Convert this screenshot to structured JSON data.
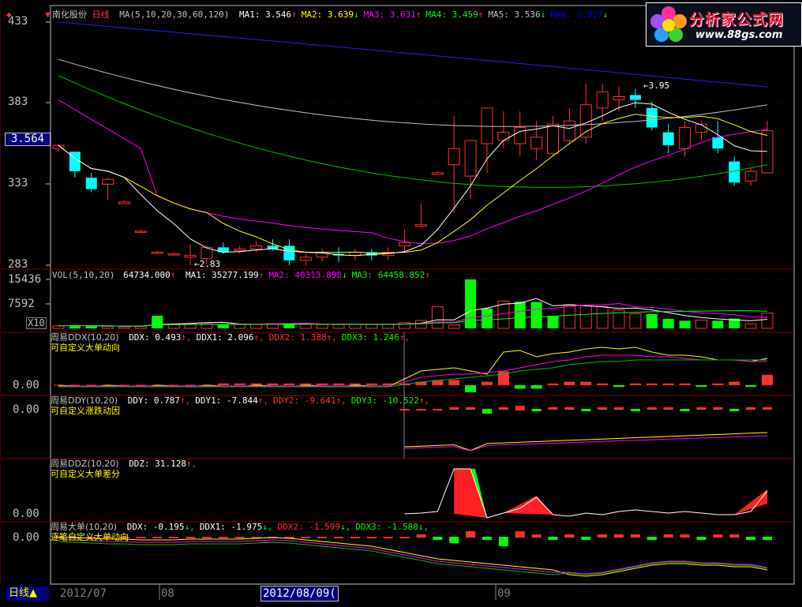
{
  "main": {
    "stock_name": "南化股份",
    "period": "日线",
    "ma_title": "MA(5,10,20,30,60,120)",
    "ma": [
      {
        "label": "MA1:",
        "value": "3.546",
        "arrow": "↑",
        "color": "#ffffff"
      },
      {
        "label": "MA2:",
        "value": "3.639",
        "arrow": "↓",
        "color": "#ffff00"
      },
      {
        "label": "MA3:",
        "value": "3.631",
        "arrow": "↑",
        "color": "#ff00ff"
      },
      {
        "label": "MA4:",
        "value": "3.459",
        "arrow": "↑",
        "color": "#00ff00"
      },
      {
        "label": "MA5:",
        "value": "3.536",
        "arrow": "↓",
        "color": "#c0c0c0"
      },
      {
        "label": "MA6:",
        "value": "3.917",
        "arrow": "↓",
        "color": "#0000ff"
      }
    ],
    "y_ticks": [
      "433",
      "383",
      "333",
      "283"
    ],
    "current_price": "3.564",
    "high_mark": "3.95",
    "low_mark": "2.83"
  },
  "vol": {
    "title": "VOL(5,10,20)",
    "value": "64734.000",
    "value_arrow": "↑",
    "ma": [
      {
        "label": "MA1:",
        "value": "35277.199",
        "arrow": "↑",
        "color": "#ffffff"
      },
      {
        "label": "MA2:",
        "value": "40313.898",
        "arrow": "↓",
        "color": "#ff00ff"
      },
      {
        "label": "MA3:",
        "value": "64458.852",
        "arrow": "↑",
        "color": "#00ff00"
      }
    ],
    "y_ticks": [
      "15436",
      "7592"
    ],
    "unit": "X10"
  },
  "ddx": {
    "title": "周易DDX(10,20)",
    "items": [
      {
        "label": "DDX:",
        "value": "0.493",
        "arrow": "↑",
        "color": "#ffffff"
      },
      {
        "label": "DDX1:",
        "value": "2.096",
        "arrow": "↑",
        "color": "#ffffff"
      },
      {
        "label": "DDX2:",
        "value": "1.388",
        "arrow": "↑",
        "color": "#ff3030"
      },
      {
        "label": "DDX3:",
        "value": "1.246",
        "arrow": "↑",
        "color": "#00ff00"
      }
    ],
    "subtitle": "可自定义大单动向",
    "zero": "0.00"
  },
  "ddy": {
    "title": "周易DDY(10,20)",
    "items": [
      {
        "label": "DDY:",
        "value": "0.787",
        "arrow": "↑",
        "color": "#ffffff"
      },
      {
        "label": "DDY1:",
        "value": "-7.844",
        "arrow": "↑",
        "color": "#ffffff"
      },
      {
        "label": "DDY2:",
        "value": "-9.641",
        "arrow": "↑",
        "color": "#ff3030"
      },
      {
        "label": "DDY3:",
        "value": "-10.522",
        "arrow": "↑",
        "color": "#00ff00"
      }
    ],
    "subtitle": "可自定义涨跌动因",
    "zero": "0.00"
  },
  "ddz": {
    "title": "周易DDZ(10,20)",
    "items": [
      {
        "label": "DDZ:",
        "value": "31.128",
        "arrow": "↑",
        "color": "#ffffff"
      }
    ],
    "subtitle": "可自定义大单差分",
    "zero": "0.00"
  },
  "big": {
    "title": "周易大单(10,20)",
    "items": [
      {
        "label": "DDX:",
        "value": "-0.195",
        "arrow": "↓",
        "color": "#ffffff"
      },
      {
        "label": "DDX1:",
        "value": "-1.975",
        "arrow": "↓",
        "color": "#ffffff"
      },
      {
        "label": "DDX2:",
        "value": "-1.599",
        "arrow": "↓",
        "color": "#ff3030"
      },
      {
        "label": "DDX3:",
        "value": "-1.588",
        "arrow": "↓",
        "color": "#00ff00"
      }
    ],
    "subtitle": "逐笔自定义大单动向",
    "zero": "0.00"
  },
  "bottom": {
    "period_tab": "日线",
    "dates": [
      "2012/07",
      "08",
      "09"
    ],
    "selected_date": "2012/08/09("
  },
  "logo": {
    "title": "分析家公式网",
    "url": "www.88gs.com"
  },
  "colors": {
    "up": "#ff3030",
    "down": "#00ffff",
    "vol_down": "#00ff00",
    "grid": "#800000",
    "axis": "#c0c0c0"
  },
  "chart_data": {
    "type": "candlestick",
    "price_scale": [
      2.83,
      4.33
    ],
    "candles": [
      {
        "o": 3.55,
        "h": 3.58,
        "l": 3.53,
        "c": 3.57
      },
      {
        "o": 3.53,
        "h": 3.53,
        "l": 3.37,
        "c": 3.41
      },
      {
        "o": 3.37,
        "h": 3.4,
        "l": 3.28,
        "c": 3.3
      },
      {
        "o": 3.33,
        "h": 3.37,
        "l": 3.23,
        "c": 3.36
      },
      {
        "o": 3.21,
        "h": 3.23,
        "l": 3.21,
        "c": 3.22
      },
      {
        "o": 3.04,
        "h": 3.05,
        "l": 3.03,
        "c": 3.04
      },
      {
        "o": 2.91,
        "h": 2.92,
        "l": 2.9,
        "c": 2.91
      },
      {
        "o": 2.9,
        "h": 2.91,
        "l": 2.89,
        "c": 2.9
      },
      {
        "o": 2.88,
        "h": 2.96,
        "l": 2.83,
        "c": 2.89
      },
      {
        "o": 2.87,
        "h": 2.95,
        "l": 2.84,
        "c": 2.94
      },
      {
        "o": 2.94,
        "h": 2.97,
        "l": 2.9,
        "c": 2.91
      },
      {
        "o": 2.92,
        "h": 2.95,
        "l": 2.9,
        "c": 2.93
      },
      {
        "o": 2.93,
        "h": 2.98,
        "l": 2.91,
        "c": 2.95
      },
      {
        "o": 2.95,
        "h": 2.99,
        "l": 2.92,
        "c": 2.93
      },
      {
        "o": 2.95,
        "h": 2.99,
        "l": 2.83,
        "c": 2.86
      },
      {
        "o": 2.86,
        "h": 2.9,
        "l": 2.83,
        "c": 2.88
      },
      {
        "o": 2.88,
        "h": 2.93,
        "l": 2.85,
        "c": 2.91
      },
      {
        "o": 2.9,
        "h": 2.94,
        "l": 2.85,
        "c": 2.89
      },
      {
        "o": 2.89,
        "h": 2.93,
        "l": 2.86,
        "c": 2.91
      },
      {
        "o": 2.91,
        "h": 2.93,
        "l": 2.86,
        "c": 2.89
      },
      {
        "o": 2.89,
        "h": 2.94,
        "l": 2.86,
        "c": 2.91
      },
      {
        "o": 2.95,
        "h": 3.05,
        "l": 2.91,
        "c": 2.97
      },
      {
        "o": 3.07,
        "h": 3.21,
        "l": 3.06,
        "c": 3.08
      },
      {
        "o": 3.39,
        "h": 3.41,
        "l": 3.39,
        "c": 3.4
      },
      {
        "o": 3.45,
        "h": 3.75,
        "l": 3.15,
        "c": 3.55
      },
      {
        "o": 3.38,
        "h": 3.55,
        "l": 3.24,
        "c": 3.6
      },
      {
        "o": 3.58,
        "h": 3.75,
        "l": 3.4,
        "c": 3.8
      },
      {
        "o": 3.6,
        "h": 3.78,
        "l": 3.55,
        "c": 3.65
      },
      {
        "o": 3.58,
        "h": 3.78,
        "l": 3.5,
        "c": 3.68
      },
      {
        "o": 3.55,
        "h": 3.72,
        "l": 3.48,
        "c": 3.62
      },
      {
        "o": 3.52,
        "h": 3.75,
        "l": 3.5,
        "c": 3.7
      },
      {
        "o": 3.6,
        "h": 3.8,
        "l": 3.58,
        "c": 3.72
      },
      {
        "o": 3.62,
        "h": 3.95,
        "l": 3.58,
        "c": 3.82
      },
      {
        "o": 3.8,
        "h": 3.95,
        "l": 3.72,
        "c": 3.9
      },
      {
        "o": 3.85,
        "h": 3.93,
        "l": 3.78,
        "c": 3.87
      },
      {
        "o": 3.88,
        "h": 3.92,
        "l": 3.8,
        "c": 3.85
      },
      {
        "o": 3.8,
        "h": 3.84,
        "l": 3.66,
        "c": 3.68
      },
      {
        "o": 3.65,
        "h": 3.7,
        "l": 3.52,
        "c": 3.57
      },
      {
        "o": 3.55,
        "h": 3.72,
        "l": 3.5,
        "c": 3.68
      },
      {
        "o": 3.65,
        "h": 3.72,
        "l": 3.6,
        "c": 3.7
      },
      {
        "o": 3.62,
        "h": 3.72,
        "l": 3.52,
        "c": 3.55
      },
      {
        "o": 3.47,
        "h": 3.5,
        "l": 3.32,
        "c": 3.34
      },
      {
        "o": 3.35,
        "h": 3.43,
        "l": 3.32,
        "c": 3.41
      },
      {
        "o": 3.4,
        "h": 3.72,
        "l": 3.4,
        "c": 3.66
      }
    ],
    "volumes": [
      {
        "v": 800,
        "up": true
      },
      {
        "v": 1000,
        "up": false
      },
      {
        "v": 700,
        "up": false
      },
      {
        "v": 600,
        "up": true
      },
      {
        "v": 500,
        "up": true
      },
      {
        "v": 600,
        "up": true
      },
      {
        "v": 4000,
        "up": false
      },
      {
        "v": 1300,
        "up": true
      },
      {
        "v": 1500,
        "up": true
      },
      {
        "v": 1700,
        "up": true
      },
      {
        "v": 1100,
        "up": false
      },
      {
        "v": 1200,
        "up": true
      },
      {
        "v": 1300,
        "up": true
      },
      {
        "v": 1500,
        "up": true
      },
      {
        "v": 1600,
        "up": false
      },
      {
        "v": 1300,
        "up": true
      },
      {
        "v": 1200,
        "up": true
      },
      {
        "v": 1200,
        "up": true
      },
      {
        "v": 1300,
        "up": true
      },
      {
        "v": 1200,
        "up": true
      },
      {
        "v": 1300,
        "up": true
      },
      {
        "v": 1800,
        "up": true
      },
      {
        "v": 2500,
        "up": true
      },
      {
        "v": 6800,
        "up": true
      },
      {
        "v": 1100,
        "up": true
      },
      {
        "v": 15436,
        "up": false
      },
      {
        "v": 6300,
        "up": false
      },
      {
        "v": 8600,
        "up": true
      },
      {
        "v": 8400,
        "up": false
      },
      {
        "v": 8300,
        "up": false
      },
      {
        "v": 4000,
        "up": false
      },
      {
        "v": 7500,
        "up": true
      },
      {
        "v": 7300,
        "up": true
      },
      {
        "v": 6900,
        "up": true
      },
      {
        "v": 5800,
        "up": true
      },
      {
        "v": 4600,
        "up": true
      },
      {
        "v": 4500,
        "up": false
      },
      {
        "v": 3000,
        "up": false
      },
      {
        "v": 2400,
        "up": false
      },
      {
        "v": 2600,
        "up": true
      },
      {
        "v": 2400,
        "up": false
      },
      {
        "v": 3100,
        "up": false
      },
      {
        "v": 1400,
        "up": true
      },
      {
        "v": 4800,
        "up": true
      }
    ]
  }
}
